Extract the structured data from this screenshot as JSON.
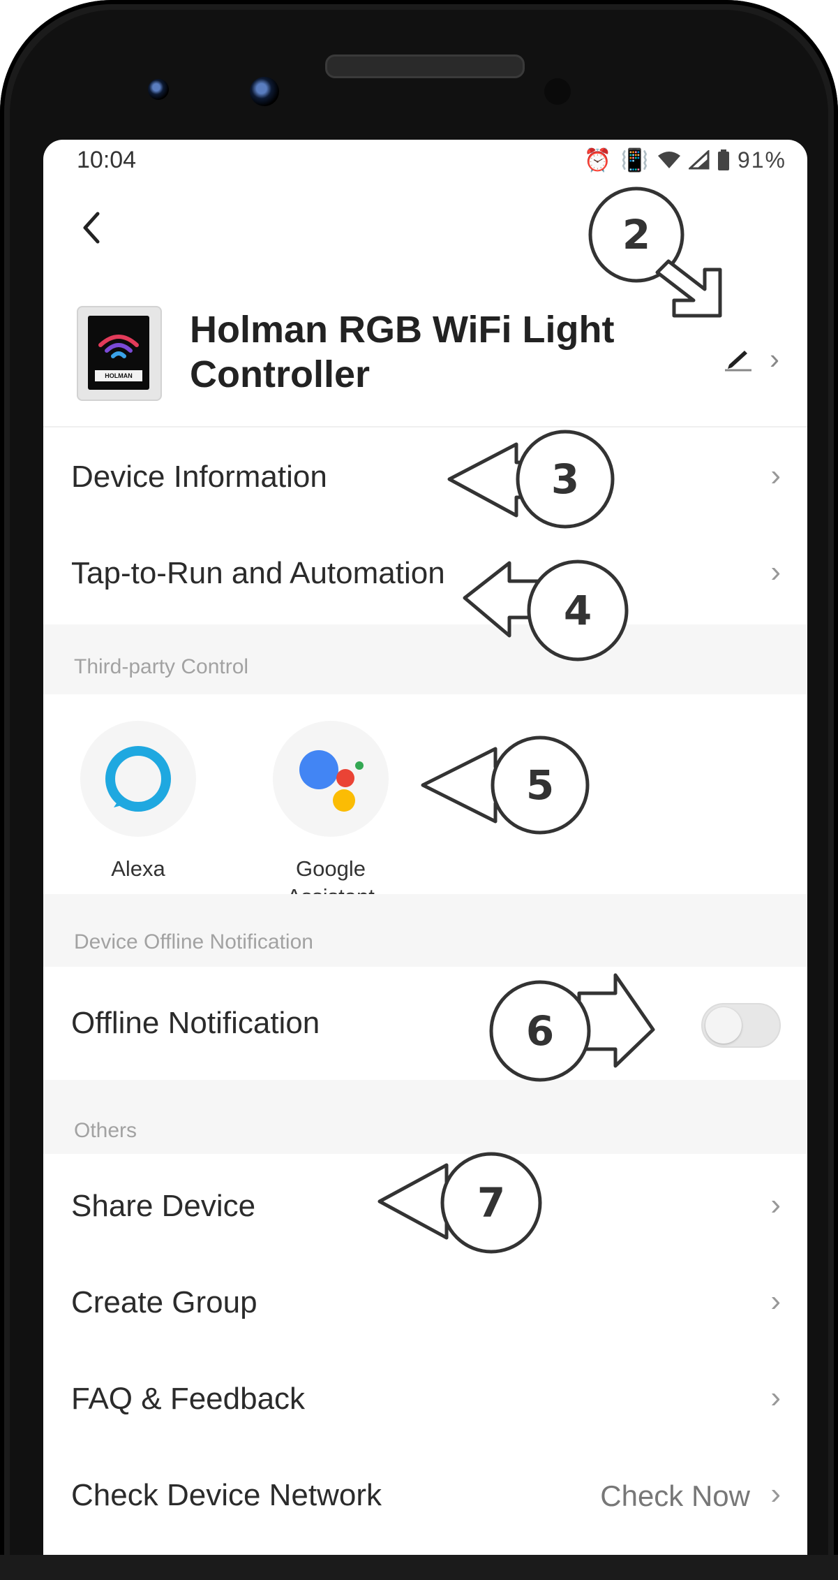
{
  "status_bar": {
    "time": "10:04",
    "battery": "91%",
    "icons": [
      "alarm-icon",
      "vibrate-icon",
      "wifi-icon",
      "signal-icon",
      "battery-icon"
    ]
  },
  "device": {
    "name": "Holman RGB WiFi Light Controller",
    "thumb_label": "HOLMAN"
  },
  "rows": {
    "device_information": "Device Information",
    "tap_to_run": "Tap-to-Run and Automation",
    "offline_notification": "Offline Notification",
    "share_device": "Share Device",
    "create_group": "Create Group",
    "faq_feedback": "FAQ & Feedback",
    "check_network": "Check Device Network",
    "check_now": "Check Now"
  },
  "sections": {
    "third_party": "Third-party Control",
    "offline": "Device Offline Notification",
    "others": "Others"
  },
  "third_party": {
    "alexa": "Alexa",
    "google_line1": "Google",
    "google_line2": "Assistant"
  },
  "toggles": {
    "offline_notification": false
  },
  "callouts": {
    "c2": "2",
    "c3": "3",
    "c4": "4",
    "c5": "5",
    "c6": "6",
    "c7": "7"
  },
  "colors": {
    "alexa": "#1fa8e0",
    "google_blue": "#4285f4",
    "google_red": "#ea4335",
    "google_yellow": "#fbbc04",
    "google_green": "#34a853"
  }
}
